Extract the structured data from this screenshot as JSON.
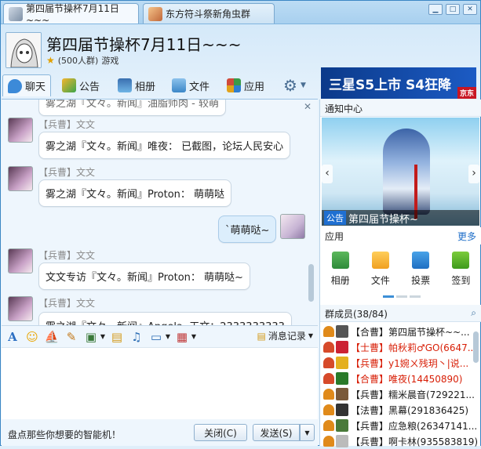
{
  "tabs": [
    {
      "label": "第四届节操杯7月11日~~~",
      "active": true
    },
    {
      "label": "东方符斗祭新角虫群",
      "active": false
    }
  ],
  "header": {
    "title": "第四届节操杯7月11日~~~",
    "member_count": "(500人群)",
    "category": "游戏"
  },
  "toolbar": {
    "items": [
      "聊天",
      "公告",
      "相册",
      "文件",
      "应用"
    ]
  },
  "ad": {
    "text": "三星S5上市 S4狂降",
    "brand": "京东"
  },
  "chat": {
    "messages": [
      {
        "sender": "【兵曹】文文",
        "text": "雾之湖『文々。新闻』唯夜： 已截图，论坛人民安心"
      },
      {
        "sender": "【兵曹】文文",
        "text": "雾之湖『文々。新闻』Proton： 萌萌哒"
      },
      {
        "sender": "",
        "text": "`萌萌哒~",
        "self": true
      },
      {
        "sender": "【兵曹】文文",
        "text": "文文专访『文々。新闻』Proton： 萌萌哒~"
      },
      {
        "sender": "【兵曹】文文",
        "text": "雾之湖『文々。新闻』Angela ·天文：2333333333"
      }
    ],
    "cut_top_text": "雾之湖『文々。新闻』油脂师肉 - 较萌"
  },
  "input_toolbar": {
    "record_label": "消息记录"
  },
  "footer": {
    "hint": "盘点那些你想要的智能机！",
    "close_label": "关闭(C)",
    "send_label": "发送(S)"
  },
  "right": {
    "notice_header": "通知中心",
    "notice_tag": "公告",
    "notice_caption": "第四届节操杯~",
    "apps_header": "应用",
    "apps_more": "更多",
    "apps": [
      "相册",
      "文件",
      "投票",
      "签到"
    ],
    "members_header": "群成员(38/84)",
    "members": [
      {
        "text": "【合曹】第四届节操杯~~...",
        "color": "#1a1a1a"
      },
      {
        "text": "【士曹】帕秋莉♂GO(6647...",
        "color": "#d81e06"
      },
      {
        "text": "【兵曹】y1婉ㄨ残玥丶|说...",
        "color": "#d81e06"
      },
      {
        "text": "【合曹】唯夜(14450890)",
        "color": "#d81e06"
      },
      {
        "text": "【兵曹】糯米晨音(729221...",
        "color": "#1a1a1a"
      },
      {
        "text": "【法曹】黑幕(291836425)",
        "color": "#1a1a1a"
      },
      {
        "text": "【兵曹】应急粮(26347141...",
        "color": "#1a1a1a"
      },
      {
        "text": "【兵曹】啊卡林(935583819)",
        "color": "#1a1a1a"
      }
    ]
  }
}
